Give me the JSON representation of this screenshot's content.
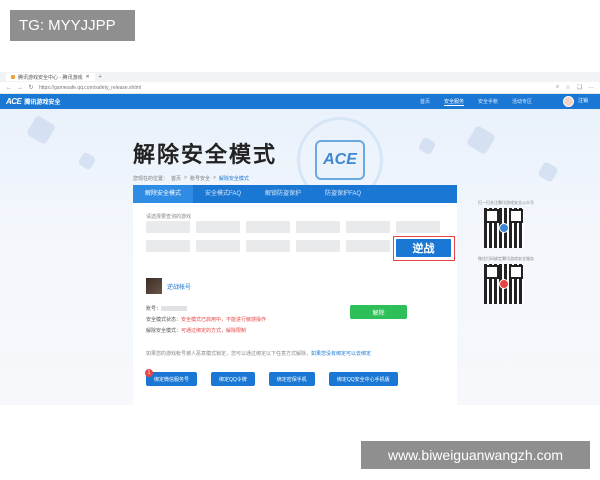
{
  "watermarks": {
    "top": "TG: MYYJJPP",
    "bottom": "www.biweiguanwangzh.com"
  },
  "browser": {
    "tab_title": "腾讯游戏安全中心 - 腾讯游戏",
    "url": "https://gamesafe.qq.com/safety_release.shtml"
  },
  "site": {
    "logo_mark": "ACE",
    "logo_text": "腾讯游戏安全",
    "nav": [
      "首页",
      "安全服务",
      "安全手帐",
      "活动专区"
    ],
    "active_nav": "安全服务",
    "login": "注销"
  },
  "hero": {
    "title": "解除安全模式",
    "emblem": "ACE",
    "breadcrumb": [
      "您现在的位置：",
      "首页",
      ">",
      "账号安全",
      ">",
      "解除安全模式"
    ]
  },
  "card": {
    "tabs": [
      "解除安全模式",
      "安全模式FAQ",
      "解锁防盗保护",
      "防盗保护FAQ"
    ],
    "active_tab": "解除安全模式",
    "section_label": "请选择要查询的游戏",
    "games": [
      "",
      "",
      "",
      "",
      "",
      "",
      "",
      "",
      "",
      "",
      "",
      "逆战"
    ],
    "selected_game": "逆战",
    "user_name": "逆战帐号",
    "info": {
      "account_label": "账号：",
      "status_label": "安全模式状态：",
      "status_value": "安全模式已启用中，不能进行敏感操作",
      "method_label": "解除安全模式：",
      "method_value": "可通过绑定的方式，解除限制"
    },
    "unlock_button": "解除",
    "tip": "如果您的游戏帐号被人恶意模式锁定，您可以通过绑定以下任意方式解除，",
    "tip_link": "如果您没有绑定可以去绑定",
    "bind_buttons": [
      "绑定微信服务号",
      "绑定QQ令牌",
      "绑定密保手机",
      "绑定QQ安全中心手机版"
    ],
    "badge": "1"
  },
  "qr": {
    "caption1": "扫一扫关注腾讯游戏安全公众号",
    "caption2": "微信扫码绑定腾讯游戏安全服务"
  }
}
